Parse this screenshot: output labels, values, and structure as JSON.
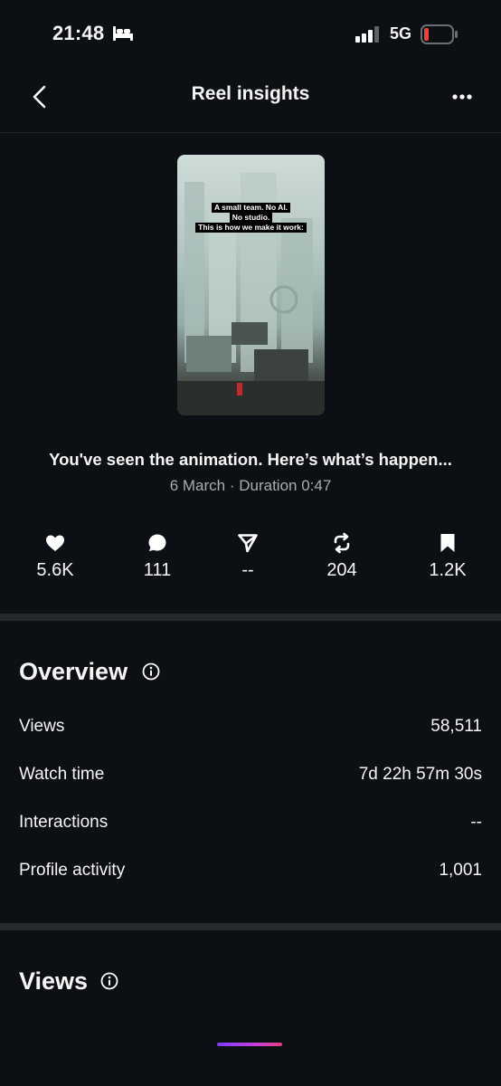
{
  "status_bar": {
    "time": "21:48",
    "network": "5G",
    "battery_color": "#ff3b30"
  },
  "nav": {
    "title": "Reel insights",
    "back_icon": "chevron-left-icon",
    "more_icon": "more-horizontal-icon"
  },
  "reel": {
    "thumbnail_caption": [
      "A small team. No AI.",
      "No studio.",
      "This is how we make it work:"
    ],
    "title": "You've seen the animation. Here’s what’s happen...",
    "meta": "6 March · Duration 0:47"
  },
  "stats": [
    {
      "icon": "heart-icon",
      "value": "5.6K"
    },
    {
      "icon": "comment-icon",
      "value": "111"
    },
    {
      "icon": "share-icon",
      "value": "--"
    },
    {
      "icon": "repost-icon",
      "value": "204"
    },
    {
      "icon": "bookmark-icon",
      "value": "1.2K"
    }
  ],
  "overview": {
    "title": "Overview",
    "rows": [
      {
        "label": "Views",
        "value": "58,511"
      },
      {
        "label": "Watch time",
        "value": "7d 22h 57m 30s"
      },
      {
        "label": "Interactions",
        "value": "--"
      },
      {
        "label": "Profile activity",
        "value": "1,001"
      }
    ]
  },
  "views_section": {
    "title": "Views"
  }
}
